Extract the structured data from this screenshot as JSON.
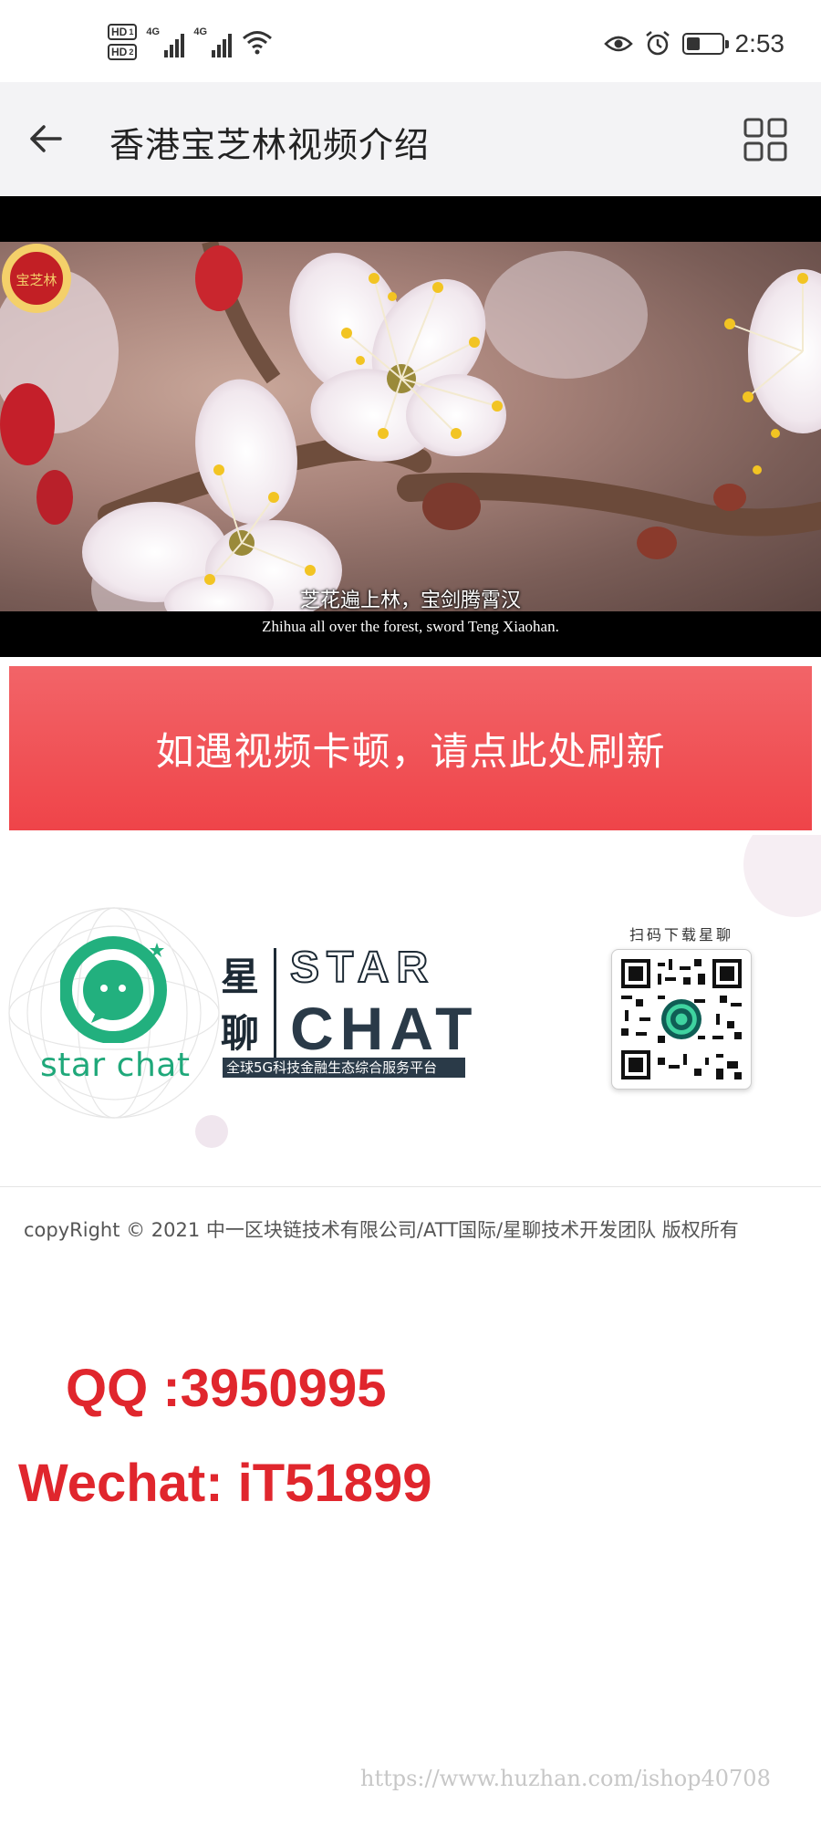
{
  "status_bar": {
    "sim1": "HD",
    "sim1_index": "1",
    "sim2": "HD",
    "sim2_index": "2",
    "net1": "4G",
    "net2": "4G",
    "time": "2:53",
    "icons": [
      "hd-icon",
      "signal-icon",
      "wifi-icon",
      "eye-icon",
      "alarm-icon",
      "battery-icon"
    ],
    "battery_level": 0.4
  },
  "app_bar": {
    "title": "香港宝芝林视频介绍",
    "icons": [
      "back-arrow-icon",
      "grid-icon"
    ]
  },
  "video": {
    "subtitle_cn": "芝花遍上林，宝剑腾霄汉",
    "subtitle_en": "Zhihua all over the forest, sword Teng Xiaohan.",
    "seal_text": "宝芝林"
  },
  "refresh": {
    "label": "如遇视频卡顿，请点此处刷新"
  },
  "promo": {
    "logo_text": "star chat",
    "brand_cn": "星聊",
    "brand_star": "STAR",
    "brand_chat": "CHAT",
    "tagline": "全球5G科技金融生态综合服务平台",
    "qr_caption": "扫码下载星聊"
  },
  "footer": {
    "copyright": "copyRight © 2021 中一区块链技术有限公司/ATT国际/星聊技术开发团队 版权所有"
  },
  "contact": {
    "qq": "QQ :3950995",
    "wechat": "Wechat: iT51899"
  },
  "watermark": "https://www.huzhan.com/ishop40708",
  "colors": {
    "accent_red": "#ef4449",
    "contact_red": "#e0262d",
    "brand_green": "#1fa87a",
    "brand_dark": "#1d2a35",
    "app_bar_bg": "#f3f3f5"
  }
}
